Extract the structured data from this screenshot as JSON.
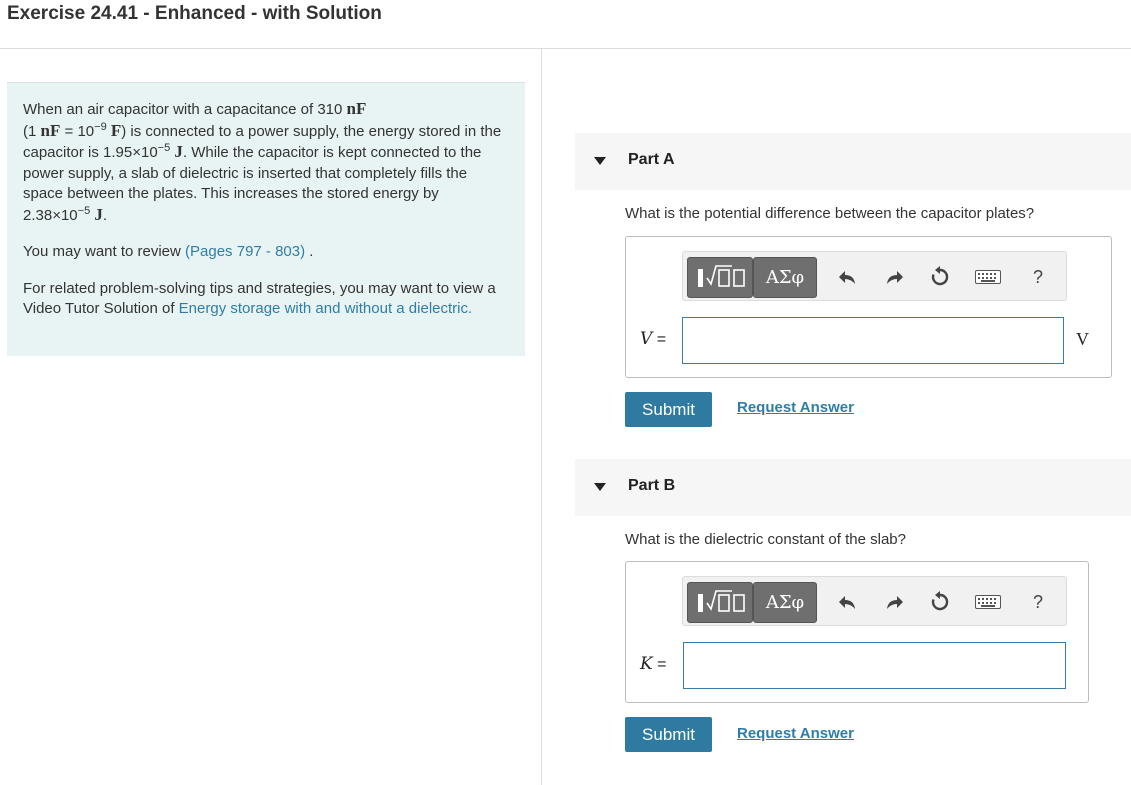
{
  "page": {
    "title": "Exercise 24.41 - Enhanced - with Solution"
  },
  "problem": {
    "p1_a": "When an air capacitor with a capacitance of 310 ",
    "unit_nF": "nF",
    "p1_b": "(1 ",
    "p1_c": " = 10",
    "exp_neg9": "−9",
    "unit_F": "F",
    "p1_d": ") is connected to a power supply, the energy stored in the capacitor is 1.95×10",
    "exp_neg5_a": "−5",
    "unit_J": "J",
    "p1_e": ". While the capacitor is kept connected to the power supply, a slab of dielectric is inserted that completely fills the space between the plates. This increases the stored energy by 2.38×10",
    "exp_neg5_b": "−5",
    "p1_f": ".",
    "review_prefix": "You may want to review ",
    "review_link": "(Pages 797 - 803)",
    "review_suffix": " .",
    "tips_prefix": "For related problem-solving tips and strategies, you may want to view a Video Tutor Solution of ",
    "tips_link": "Energy storage with and without a dielectric",
    "tips_suffix": "."
  },
  "parts": [
    {
      "label": "Part A",
      "question": "What is the potential difference between the capacitor plates?",
      "variable": "V",
      "equals": "=",
      "unit": "V",
      "input_value": "",
      "submit_label": "Submit",
      "request_label": "Request Answer"
    },
    {
      "label": "Part B",
      "question": "What is the dielectric constant of the slab?",
      "variable": "K",
      "equals": "=",
      "input_value": "",
      "submit_label": "Submit",
      "request_label": "Request Answer"
    }
  ],
  "toolbar": {
    "symbols_label": "ΑΣφ",
    "help_label": "?",
    "icons": [
      "templates-icon",
      "greek-symbols-icon",
      "undo-icon",
      "redo-icon",
      "reset-icon",
      "keyboard-icon",
      "help-icon"
    ]
  }
}
